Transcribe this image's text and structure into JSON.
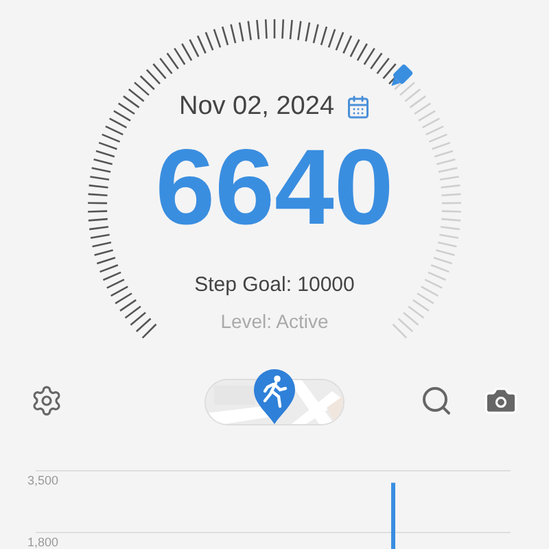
{
  "gauge": {
    "date": "Nov 02, 2024",
    "steps": "6640",
    "goal": "Step Goal: 10000",
    "status": "Level: Active"
  },
  "chart": {
    "chart_data": {
      "type": "bar",
      "yticks": [
        {
          "value": 1800,
          "label": "1,800"
        },
        {
          "value": 3500,
          "label": "3,500"
        }
      ],
      "ylim": [
        1800,
        3500
      ],
      "values": [
        null,
        null,
        null,
        null,
        null,
        null,
        null,
        null,
        null,
        null,
        3170,
        null,
        null,
        null
      ]
    }
  }
}
